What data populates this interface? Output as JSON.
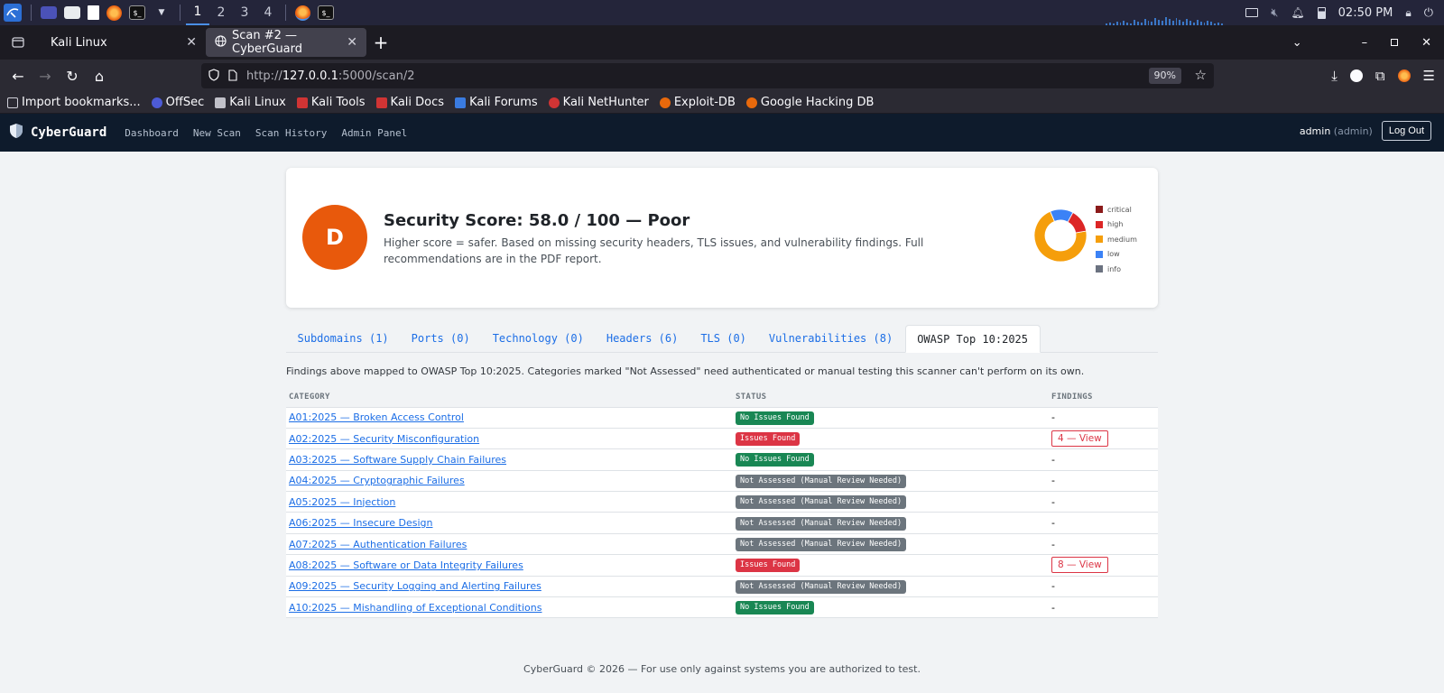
{
  "taskbar": {
    "workspaces": [
      "1",
      "2",
      "3",
      "4"
    ],
    "active_workspace": "1",
    "clock": "02:50 PM",
    "icons": [
      "kali-menu-icon",
      "desktop-icon",
      "file-manager-icon",
      "text-editor-icon",
      "firefox-icon",
      "terminal-icon"
    ]
  },
  "browser": {
    "tabs": [
      {
        "title": "Kali Linux",
        "active": false
      },
      {
        "title": "Scan #2 — CyberGuard",
        "active": true
      }
    ],
    "url_prefix": "http://",
    "url_host": "127.0.0.1",
    "url_path": ":5000/scan/2",
    "zoom": "90%",
    "bookmarks": [
      {
        "label": "Import bookmarks...",
        "color": "#cfcfd8"
      },
      {
        "label": "OffSec",
        "color": "#4d5bd6"
      },
      {
        "label": "Kali Linux",
        "color": "#c0c0c8"
      },
      {
        "label": "Kali Tools",
        "color": "#d03434"
      },
      {
        "label": "Kali Docs",
        "color": "#d03434"
      },
      {
        "label": "Kali Forums",
        "color": "#3a7be0"
      },
      {
        "label": "Kali NetHunter",
        "color": "#d03434"
      },
      {
        "label": "Exploit-DB",
        "color": "#e8690c"
      },
      {
        "label": "Google Hacking DB",
        "color": "#e8690c"
      }
    ]
  },
  "app": {
    "brand": "CyberGuard",
    "nav": [
      "Dashboard",
      "New Scan",
      "Scan History",
      "Admin Panel"
    ],
    "user": "admin",
    "role": "(admin)",
    "logout": "Log Out"
  },
  "score": {
    "grade": "D",
    "title": "Security Score: 58.0 / 100 — Poor",
    "description": "Higher score = safer. Based on missing security headers, TLS issues, and vulnerability findings. Full recommendations are in the PDF report."
  },
  "chart_data": {
    "type": "pie",
    "categories": [
      "critical",
      "high",
      "medium",
      "low",
      "info"
    ],
    "values": [
      0,
      1,
      5,
      1,
      0
    ],
    "colors": [
      "#8b1a1a",
      "#dc2626",
      "#f59e0b",
      "#3b82f6",
      "#6b7280"
    ]
  },
  "tabs": [
    {
      "label": "Subdomains (1)",
      "active": false
    },
    {
      "label": "Ports (0)",
      "active": false
    },
    {
      "label": "Technology (0)",
      "active": false
    },
    {
      "label": "Headers (6)",
      "active": false
    },
    {
      "label": "TLS (0)",
      "active": false
    },
    {
      "label": "Vulnerabilities (8)",
      "active": false
    },
    {
      "label": "OWASP Top 10:2025",
      "active": true
    }
  ],
  "note": "Findings above mapped to OWASP Top 10:2025. Categories marked \"Not Assessed\" need authenticated or manual testing this scanner can't perform on its own.",
  "table": {
    "headers": [
      "CATEGORY",
      "STATUS",
      "FINDINGS"
    ],
    "rows": [
      {
        "category": "A01:2025 — Broken Access Control",
        "status": "No Issues Found",
        "kind": "ok",
        "findings": "-"
      },
      {
        "category": "A02:2025 — Security Misconfiguration",
        "status": "Issues Found",
        "kind": "bad",
        "findings": "4 — View"
      },
      {
        "category": "A03:2025 — Software Supply Chain Failures",
        "status": "No Issues Found",
        "kind": "ok",
        "findings": "-"
      },
      {
        "category": "A04:2025 — Cryptographic Failures",
        "status": "Not Assessed (Manual Review Needed)",
        "kind": "na",
        "findings": "-"
      },
      {
        "category": "A05:2025 — Injection",
        "status": "Not Assessed (Manual Review Needed)",
        "kind": "na",
        "findings": "-"
      },
      {
        "category": "A06:2025 — Insecure Design",
        "status": "Not Assessed (Manual Review Needed)",
        "kind": "na",
        "findings": "-"
      },
      {
        "category": "A07:2025 — Authentication Failures",
        "status": "Not Assessed (Manual Review Needed)",
        "kind": "na",
        "findings": "-"
      },
      {
        "category": "A08:2025 — Software or Data Integrity Failures",
        "status": "Issues Found",
        "kind": "bad",
        "findings": "8 — View"
      },
      {
        "category": "A09:2025 — Security Logging and Alerting Failures",
        "status": "Not Assessed (Manual Review Needed)",
        "kind": "na",
        "findings": "-"
      },
      {
        "category": "A10:2025 — Mishandling of Exceptional Conditions",
        "status": "No Issues Found",
        "kind": "ok",
        "findings": "-"
      }
    ]
  },
  "footer": "CyberGuard © 2026 — For use only against systems you are authorized to test."
}
